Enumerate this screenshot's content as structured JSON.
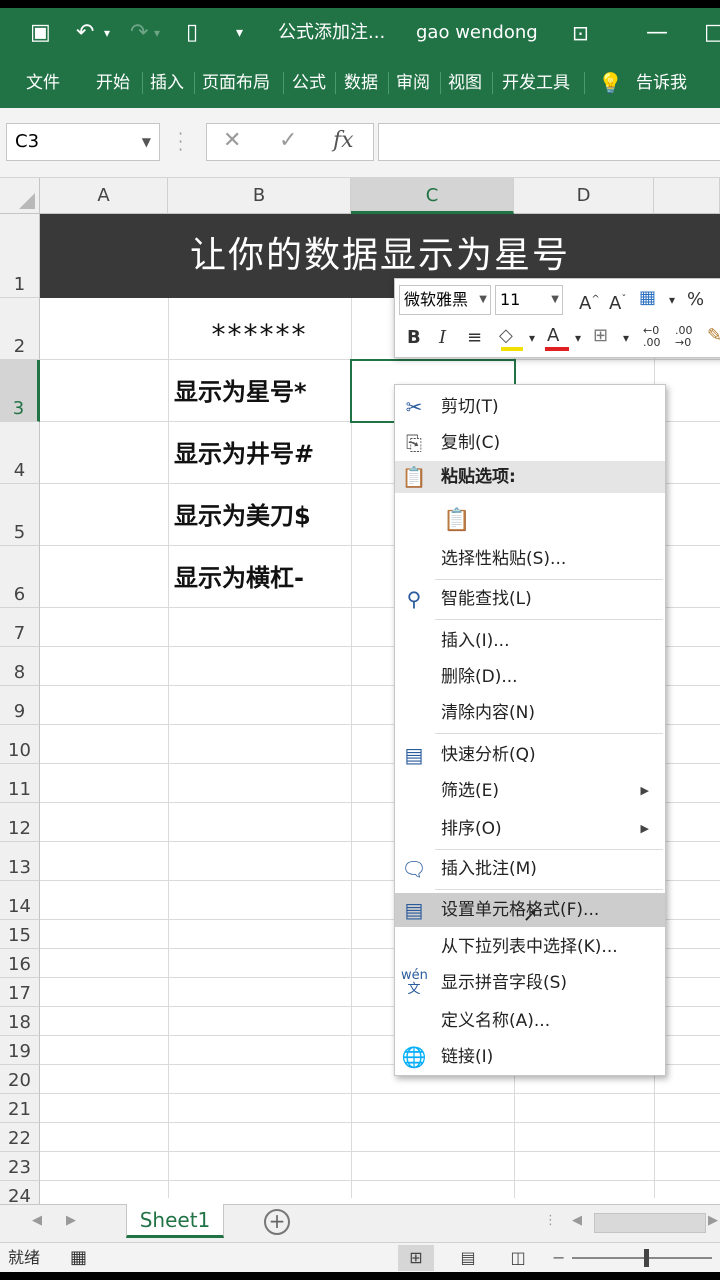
{
  "titlebar": {
    "filename": "公式添加注...",
    "user": "gao wendong"
  },
  "ribbon": {
    "tabs": [
      "文件",
      "开始",
      "插入",
      "页面布局",
      "公式",
      "数据",
      "审阅",
      "视图",
      "开发工具"
    ],
    "tell_me": "告诉我"
  },
  "formula_bar": {
    "name_box": "C3",
    "fx_label": "fx",
    "value": ""
  },
  "columns": [
    "A",
    "B",
    "C",
    "D"
  ],
  "rows": [
    "1",
    "2",
    "3",
    "4",
    "5",
    "6",
    "7",
    "8",
    "9",
    "10",
    "11",
    "12",
    "13",
    "14",
    "15",
    "16",
    "17",
    "18",
    "19",
    "20",
    "21",
    "22",
    "23",
    "24"
  ],
  "cells": {
    "title": "让你的数据显示为星号",
    "b2": "******",
    "b3": "显示为星号*",
    "b4": "显示为井号#",
    "b5": "显示为美刀$",
    "b6": "显示为横杠-"
  },
  "mini_toolbar": {
    "font": "微软雅黑",
    "size": "11",
    "percent": "%"
  },
  "context_menu": {
    "cut": "剪切(T)",
    "copy": "复制(C)",
    "paste_options": "粘贴选项:",
    "paste_special": "选择性粘贴(S)...",
    "smart_lookup": "智能查找(L)",
    "insert": "插入(I)...",
    "delete": "删除(D)...",
    "clear": "清除内容(N)",
    "quick_analysis": "快速分析(Q)",
    "filter": "筛选(E)",
    "sort": "排序(O)",
    "insert_comment": "插入批注(M)",
    "format_cells": "设置单元格格式(F)...",
    "pick_list": "从下拉列表中选择(K)...",
    "phonetic": "显示拼音字段(S)",
    "define_name": "定义名称(A)...",
    "link": "链接(I)"
  },
  "sheet": {
    "name": "Sheet1"
  },
  "status": {
    "ready": "就绪"
  },
  "colors": {
    "excel_green": "#217346",
    "title_bg": "#393939"
  }
}
